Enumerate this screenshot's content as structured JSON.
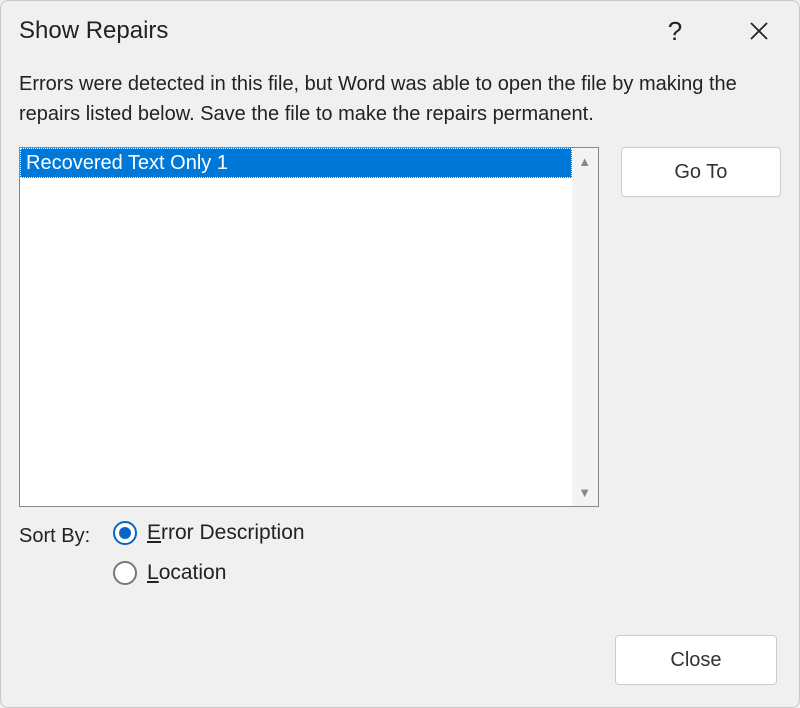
{
  "dialog": {
    "title": "Show Repairs",
    "description": "Errors were detected in this file, but Word was able to open the file by making the repairs listed below.  Save the file to make the repairs permanent."
  },
  "list": {
    "items": [
      {
        "label": "Recovered Text Only 1",
        "selected": true
      }
    ]
  },
  "buttons": {
    "goto": "Go To",
    "close": "Close"
  },
  "sort": {
    "label": "Sort By:",
    "options": [
      {
        "prefix": "E",
        "rest": "rror Description",
        "checked": true
      },
      {
        "prefix": "L",
        "rest": "ocation",
        "checked": false
      }
    ]
  }
}
